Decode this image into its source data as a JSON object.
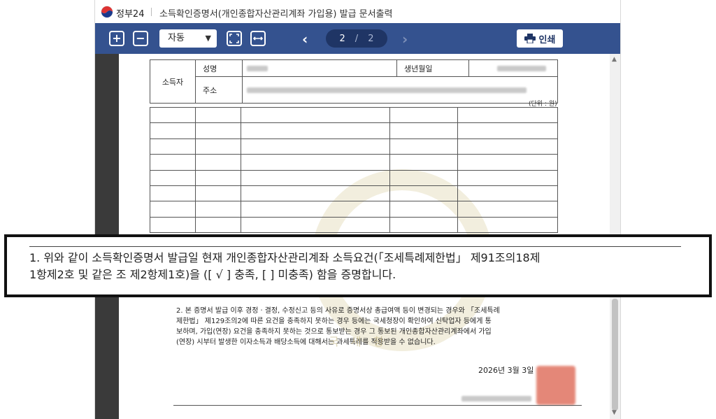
{
  "titlebar": {
    "brand": "정부24",
    "doc_title": "소득확인증명서(개인종합자산관리계좌 가입용) 발급 문서출력"
  },
  "toolbar": {
    "zoom_in_icon": "+",
    "zoom_out_icon": "−",
    "zoom_value": "자동",
    "current_page": "2",
    "page_separator": "/",
    "total_pages": "2",
    "print_label": "인쇄"
  },
  "form": {
    "earner_label": "소득자",
    "name_label": "성명",
    "birth_label": "생년월일",
    "address_label": "주소",
    "unit_note": "(단위 : 원)"
  },
  "watermark_text": "국 세 청",
  "notice_1": "1. 위와 같이 소득확인증명서 발급일 현재 개인종합자산관리계좌 소득요건(「조세특례제한법」 제91조의18제\n    1항제2호 및 같은 조 제2항제1호)을 ([ √ ] 충족, [   ] 미충족) 함을 증명합니다.",
  "notice_2": "2. 본 증명서 발급 이후 경정ㆍ결정, 수정신고 등의 사유로 증명서상 총급여액 등이 변경되는 경우와 「조세특례\n제한법」 제129조의2에 따른 요건을 충족하지 못하는 경우 등에는 국세청장이 확인하여 신탁업자 등에게 통\n보하며, 가입(연장) 요건을 충족하지 못하는 것으로 통보받는 경우 그 통보된 개인종합자산관리계좌에서 가입\n(연장) 시부터 발생한 이자소득과 배당소득에 대해서는 과세특례를 적용받을 수 없습니다.",
  "issue_date": "2026년 3월 3일",
  "colors": {
    "toolbar": "#34528f",
    "pill": "#1f3565",
    "stamp": "#e27b6a"
  }
}
